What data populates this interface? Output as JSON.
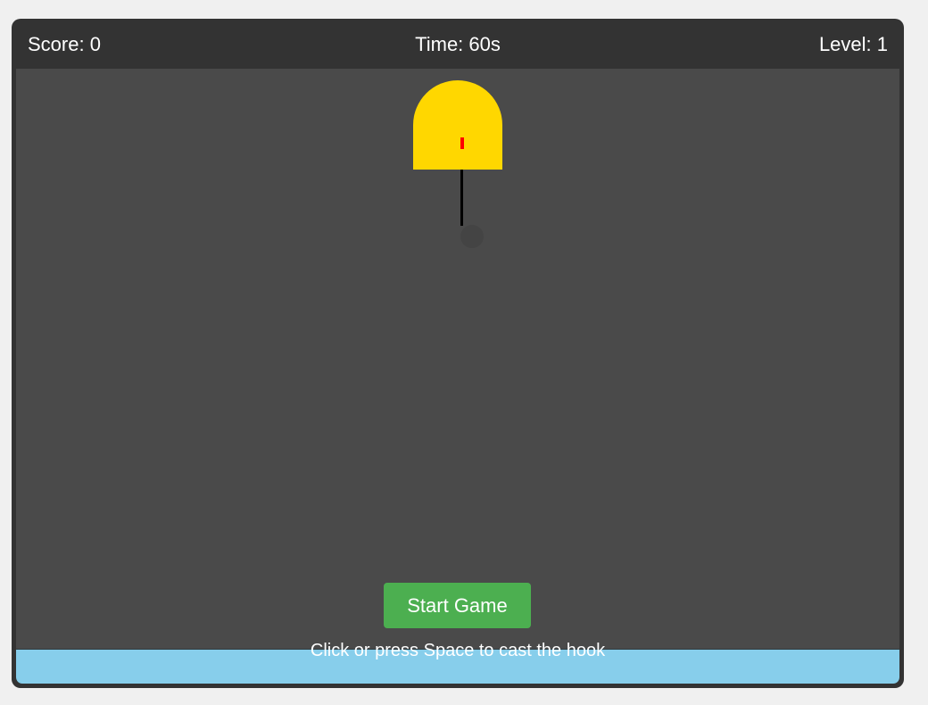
{
  "hud": {
    "score_label": "Score: 0",
    "time_label": "Time: 60s",
    "level_label": "Level: 1"
  },
  "controls": {
    "start_label": "Start Game",
    "instructions": "Click or press Space to cast the hook"
  },
  "colors": {
    "page_background": "#f0f0f0",
    "frame": "#333333",
    "play_area": "#4a4a4a",
    "water": "#87ceeb",
    "claw": "#ffd700",
    "claw_mark": "#ff0000",
    "rope": "#000000",
    "hook": "#444444",
    "start_button": "#4caf50"
  }
}
